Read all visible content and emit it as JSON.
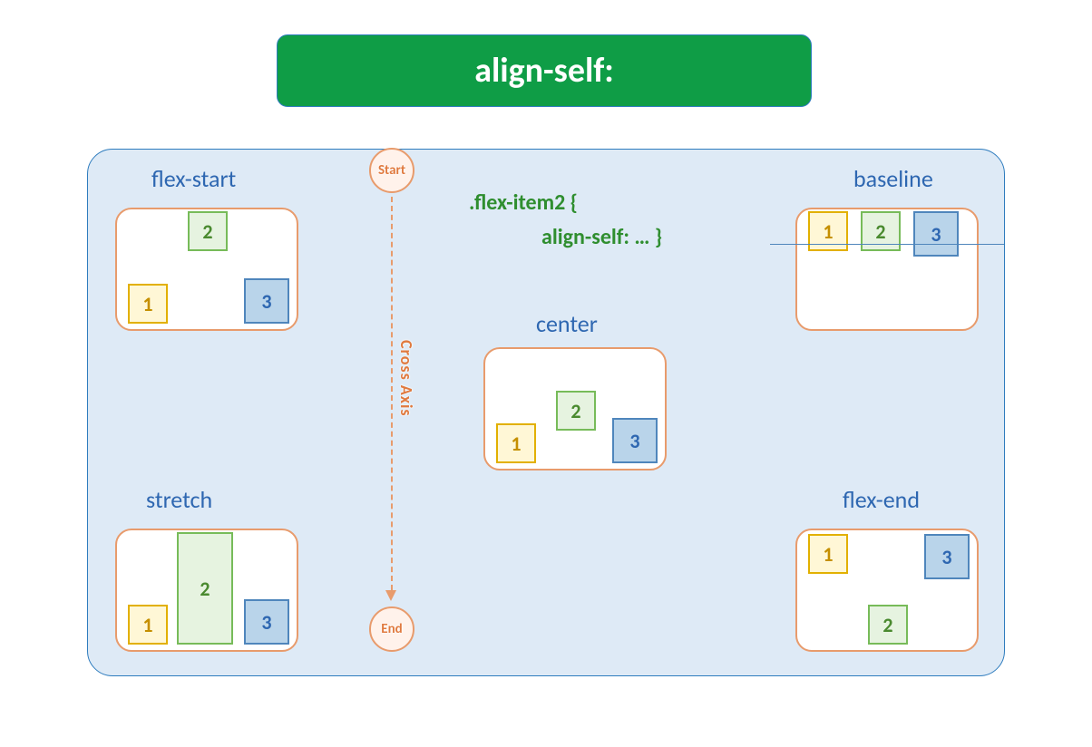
{
  "title": "align-self:",
  "code": {
    "line1": ".flex-item2 {",
    "line2": "align-self: … }"
  },
  "axis": {
    "start": "Start",
    "end": "End",
    "label": "Cross Axis"
  },
  "examples": {
    "flex_start": {
      "label": "flex-start",
      "items": [
        "1",
        "2",
        "3"
      ]
    },
    "stretch": {
      "label": "stretch",
      "items": [
        "1",
        "2",
        "3"
      ]
    },
    "center": {
      "label": "center",
      "items": [
        "1",
        "2",
        "3"
      ]
    },
    "baseline": {
      "label": "baseline",
      "items": [
        "1",
        "2",
        "3"
      ]
    },
    "flex_end": {
      "label": "flex-end",
      "items": [
        "1",
        "2",
        "3"
      ]
    }
  }
}
